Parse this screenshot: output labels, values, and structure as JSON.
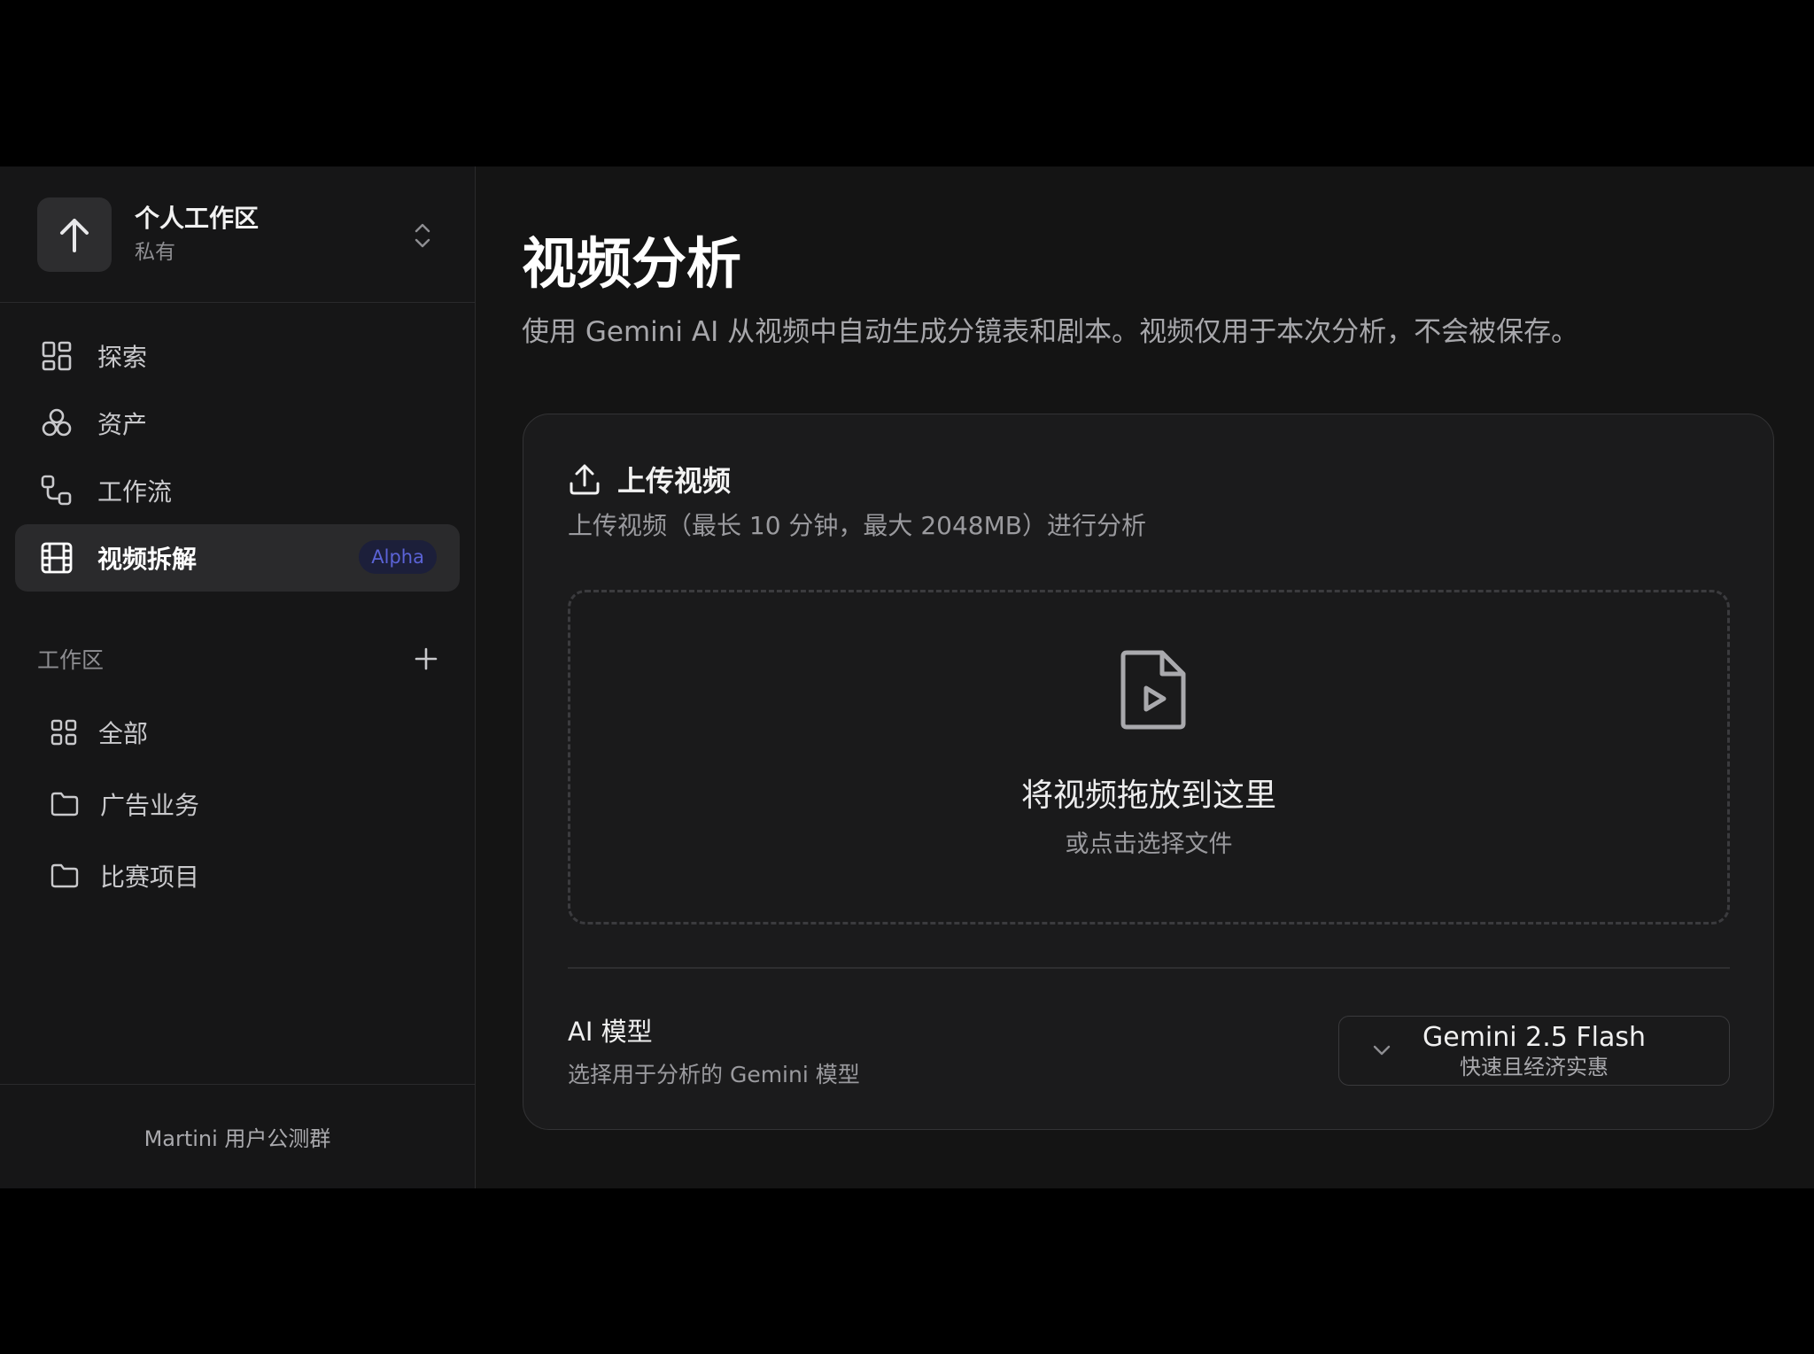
{
  "workspace": {
    "name": "个人工作区",
    "visibility": "私有",
    "avatar_icon": "arrow-up-icon"
  },
  "nav": {
    "items": [
      {
        "label": "探索",
        "icon": "grid-icon"
      },
      {
        "label": "资产",
        "icon": "assets-icon"
      },
      {
        "label": "工作流",
        "icon": "workflow-icon"
      },
      {
        "label": "视频拆解",
        "icon": "film-icon",
        "badge": "Alpha",
        "active": true
      }
    ]
  },
  "workspaces_section": {
    "title": "工作区",
    "add_icon": "plus-icon",
    "items": [
      {
        "label": "全部",
        "icon": "grid-icon"
      },
      {
        "label": "广告业务",
        "icon": "folder-icon"
      },
      {
        "label": "比赛项目",
        "icon": "folder-icon"
      }
    ]
  },
  "footer": {
    "text": "Martini 用户公测群"
  },
  "page": {
    "title": "视频分析",
    "description": "使用 Gemini AI 从视频中自动生成分镜表和剧本。视频仅用于本次分析，不会被保存。"
  },
  "upload_card": {
    "title": "上传视频",
    "subtitle": "上传视频（最长 10 分钟，最大 2048MB）进行分析",
    "dropzone_title": "将视频拖放到这里",
    "dropzone_subtitle": "或点击选择文件",
    "model_label": "AI 模型",
    "model_hint": "选择用于分析的 Gemini 模型",
    "model_selected": "Gemini 2.5 Flash",
    "model_selected_desc": "快速且经济实惠"
  },
  "colors": {
    "background": "#141414",
    "sidebar": "#161617",
    "active_item": "#2a2a2c",
    "badge_text": "#5b63d6"
  }
}
